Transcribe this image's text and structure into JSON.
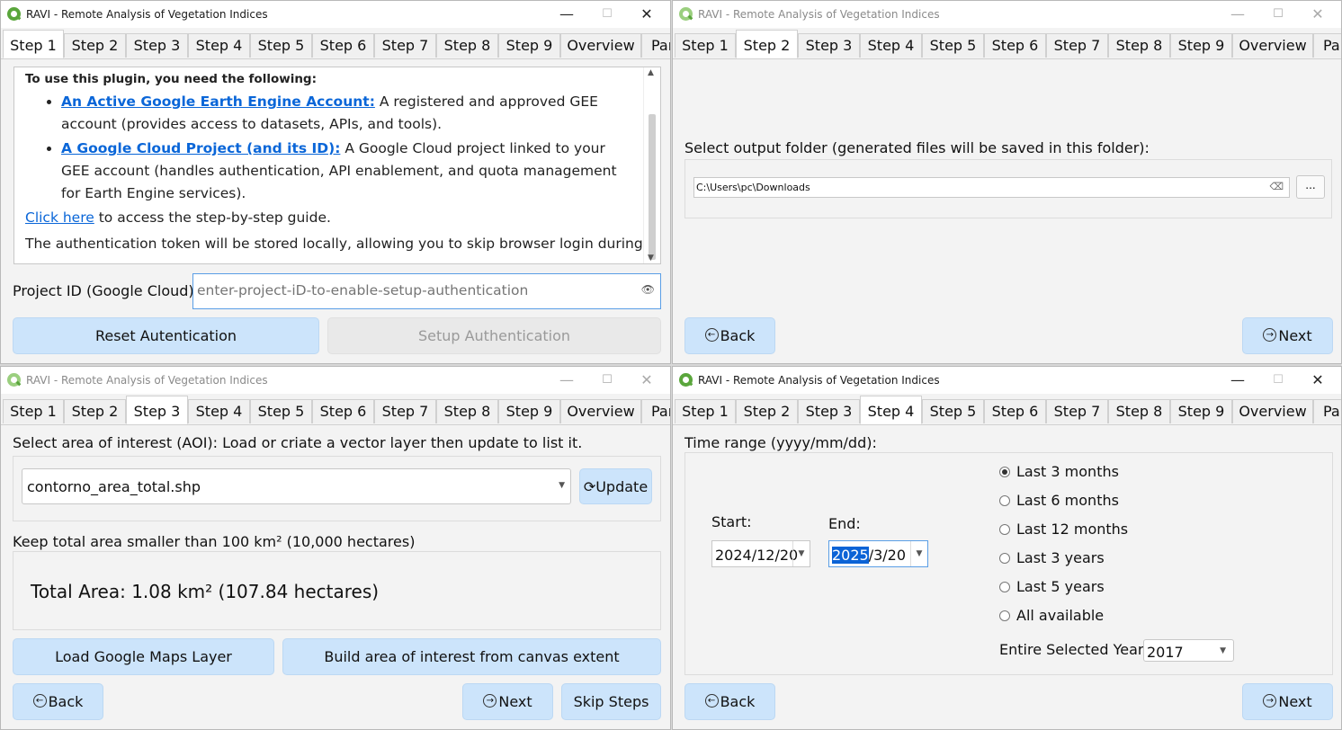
{
  "app_title": "RAVI - Remote Analysis of Vegetation Indices",
  "window_controls": {
    "minimize": "—",
    "maximize": "☐",
    "close": "✕"
  },
  "tabs": [
    "Step 1",
    "Step 2",
    "Step 3",
    "Step 4",
    "Step 5",
    "Step 6",
    "Step 7",
    "Step 8",
    "Step 9",
    "Overview",
    "Par"
  ],
  "w1": {
    "active_tab": "Step 1",
    "info": {
      "requirements": "To use this plugin, you need the following:",
      "item1_link": "An Active Google Earth Engine Account:",
      "item1_text": " A registered and approved GEE account (provides access to datasets, APIs, and tools).",
      "item2_link": "A Google Cloud Project (and its ID):",
      "item2_text": " A Google Cloud project linked to your GEE account (handles authentication, API enablement, and quota management for Earth Engine services).",
      "guide_link": "Click here",
      "guide_text": " to access the step-by-step guide.",
      "token_text": "The authentication token will be stored locally, allowing you to skip browser login during future"
    },
    "project_label": "Project ID (Google Cloud):",
    "project_placeholder": "enter-project-iD-to-enable-setup-authentication",
    "eye_icon": "👁",
    "reset_button": "Reset Autentication",
    "setup_button": "Setup Authentication"
  },
  "w2": {
    "active_tab": "Step 2",
    "folder_label": "Select output folder (generated files will be saved in this folder):",
    "folder_value": "C:\\Users\\pc\\Downloads",
    "clear_icon": "⌫",
    "browse_button": "...",
    "back_button": "Back",
    "next_button": "Next"
  },
  "w3": {
    "active_tab": "Step 3",
    "aoi_label": "Select area of interest (AOI):  Load or criate a vector layer then update to list it.",
    "aoi_value": "contorno_area_total.shp",
    "update_button": "Update",
    "area_hint": "Keep total area smaller than 100 km² (10,000 hectares)",
    "total_area": "Total Area: 1.08 km² (107.84 hectares)",
    "load_maps_button": "Load Google Maps Layer",
    "build_aoi_button": "Build area of interest from canvas extent",
    "back_button": "Back",
    "next_button": "Next",
    "skip_button": "Skip Steps"
  },
  "w4": {
    "active_tab": "Step 4",
    "time_label": "Time range (yyyy/mm/dd):",
    "start_label": "Start:",
    "end_label": "End:",
    "start_value": "2024/12/20",
    "end_year_selected": "2025",
    "end_rest": "/3/20",
    "options": [
      "Last 3 months",
      "Last 6 months",
      "Last 12 months",
      "Last 3 years",
      "Last 5 years",
      "All available"
    ],
    "selected_option": "Last 3 months",
    "year_label": "Entire Selected Year:",
    "year_value": "2017",
    "back_button": "Back",
    "next_button": "Next"
  }
}
